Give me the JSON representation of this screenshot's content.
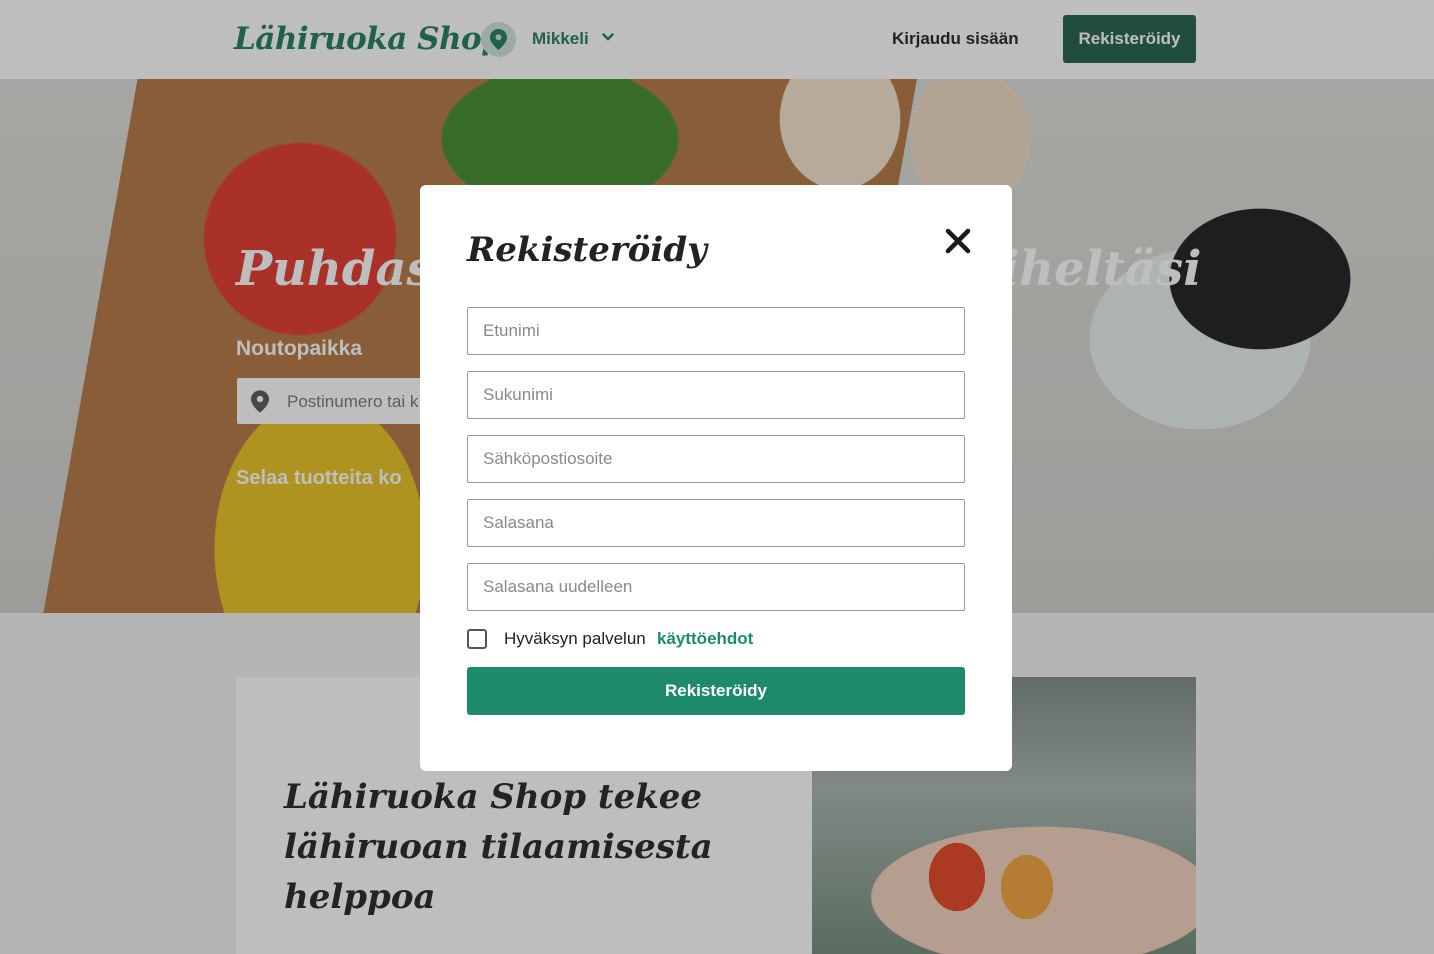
{
  "header": {
    "logo": "Lähiruoka Shop",
    "location": "Mikkeli",
    "login_label": "Kirjaudu sisään",
    "register_label": "Rekisteröidy",
    "colors": {
      "brand": "#1e7a5c",
      "button": "#1d5e4b"
    }
  },
  "hero": {
    "title_start": "Puhdast",
    "title_end": "iheltäsi",
    "pickup_label": "Noutopaikka",
    "search_placeholder": "Postinumero tai k",
    "browse_text": "Selaa tuotteita ko"
  },
  "info": {
    "title": "Lähiruoka Shop tekee lähiruoan tilaamisesta helppoa"
  },
  "modal": {
    "title": "Rekisteröidy",
    "fields": {
      "first_name": "Etunimi",
      "last_name": "Sukunimi",
      "email": "Sähköpostiosoite",
      "password": "Salasana",
      "password_again": "Salasana uudelleen"
    },
    "terms_text": "Hyväksyn palvelun",
    "terms_link": "käyttöehdot",
    "submit_label": "Rekisteröidy",
    "accent_color": "#1e8a6c"
  }
}
